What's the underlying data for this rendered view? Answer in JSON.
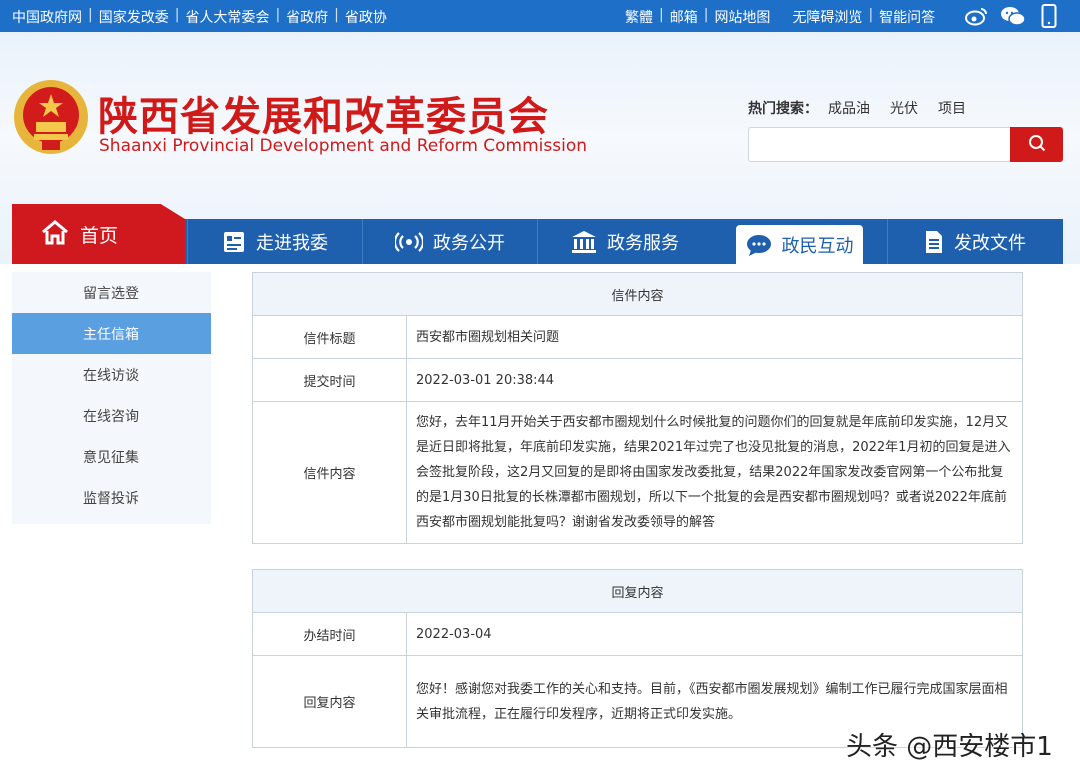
{
  "topbar": {
    "left_links": [
      "中国政府网",
      "国家发改委",
      "省人大常委会",
      "省政府",
      "省政协"
    ],
    "right_links_a": [
      "繁體",
      "邮箱",
      "网站地图"
    ],
    "right_links_b": [
      "无障碍浏览",
      "智能问答"
    ],
    "icons": [
      "weibo-icon",
      "wechat-icon",
      "mobile-icon"
    ]
  },
  "header": {
    "title_cn": "陕西省发展和改革委员会",
    "title_en": "Shaanxi Provincial Development and Reform Commission",
    "hot_label": "热门搜索：",
    "hot_terms": [
      "成品油",
      "光伏",
      "项目"
    ],
    "search_placeholder": ""
  },
  "nav": {
    "home": "首页",
    "items": [
      "走进我委",
      "政务公开",
      "政务服务",
      "政民互动",
      "发改文件"
    ],
    "active_index": 3
  },
  "sidebar": {
    "items": [
      "留言选登",
      "主任信箱",
      "在线访谈",
      "在线咨询",
      "意见征集",
      "监督投诉"
    ],
    "active_index": 1
  },
  "letter": {
    "header": "信件内容",
    "rows": [
      {
        "key": "信件标题",
        "value": "西安都市圈规划相关问题"
      },
      {
        "key": "提交时间",
        "value": "2022-03-01 20:38:44"
      },
      {
        "key": "信件内容",
        "value": "您好，去年11月开始关于西安都市圈规划什么时候批复的问题你们的回复就是年底前印发实施，12月又是近日即将批复，年底前印发实施，结果2021年过完了也没见批复的消息，2022年1月初的回复是进入会签批复阶段，这2月又回复的是即将由国家发改委批复，结果2022年国家发改委官网第一个公布批复的是1月30日批复的长株潭都市圈规划，所以下一个批复的会是西安都市圈规划吗？或者说2022年底前西安都市圈规划能批复吗？谢谢省发改委领导的解答"
      }
    ]
  },
  "reply": {
    "header": "回复内容",
    "rows": [
      {
        "key": "办结时间",
        "value": "2022-03-04"
      },
      {
        "key": "回复内容",
        "value": "您好！感谢您对我委工作的关心和支持。目前，《西安都市圈发展规划》编制工作已履行完成国家层面相关审批流程，正在履行印发程序，近期将正式印发实施。"
      }
    ]
  },
  "watermark": "头条 @西安楼市1"
}
